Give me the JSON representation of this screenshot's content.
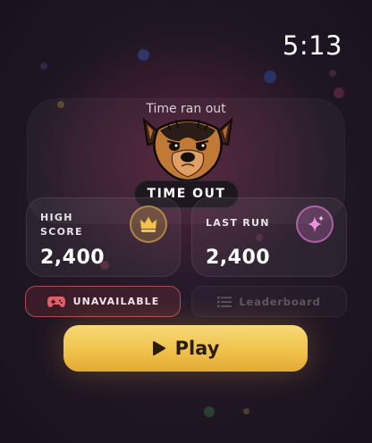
{
  "status_bar": {
    "time": "5:13"
  },
  "screen": {
    "subtitle": "Time ran out",
    "badge": "TIME OUT",
    "mascot": "dog-mascot"
  },
  "stats": {
    "high_score": {
      "label_line1": "HIGH",
      "label_line2": "SCORE",
      "value": "2,400",
      "icon": "crown-icon",
      "accent": "#f3c44b"
    },
    "last_run": {
      "label": "LAST RUN",
      "value": "2,400",
      "icon": "sparkle-icon",
      "accent": "#e57bd3"
    }
  },
  "actions": {
    "unavailable_label": "UNAVAILABLE",
    "unavailable_icon": "gamepad-icon",
    "unavailable_color": "#e0606a",
    "leaderboard_label": "Leaderboard",
    "leaderboard_icon": "list-icon",
    "play_label": "Play",
    "play_icon": "play-icon",
    "play_color": "#f2c95a"
  }
}
